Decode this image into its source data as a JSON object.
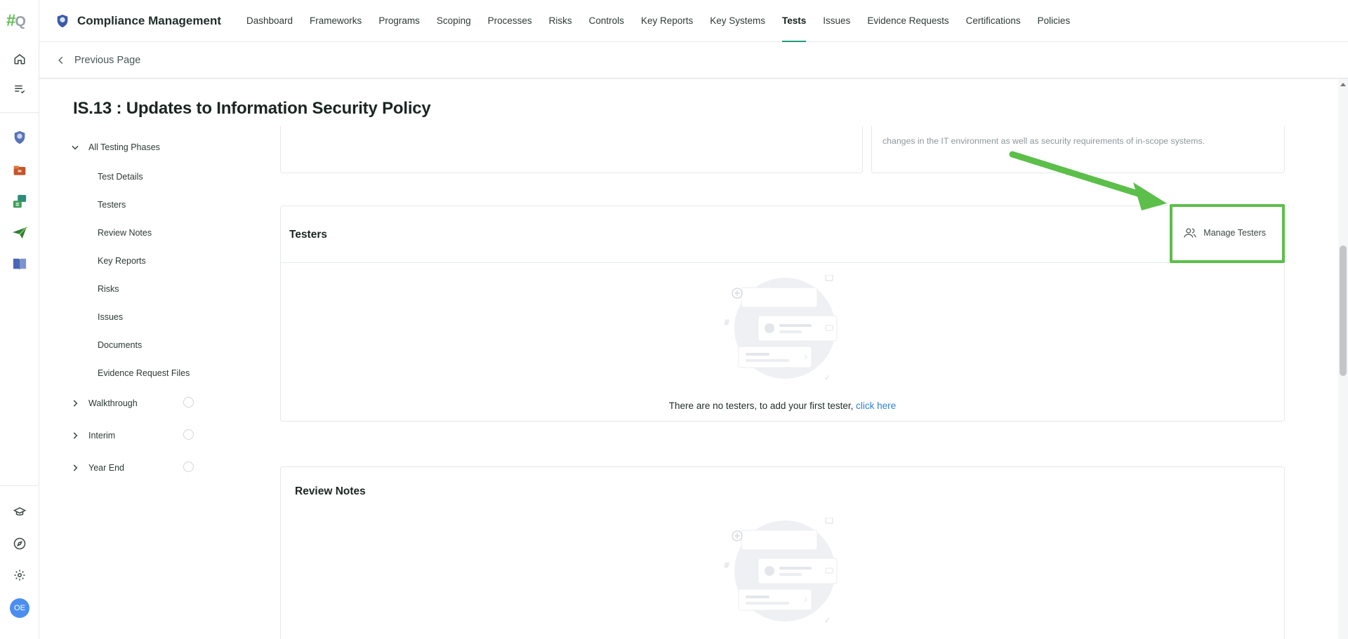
{
  "app": {
    "logo_hash": "#",
    "logo_q": "Q",
    "title": "Compliance Management"
  },
  "nav": {
    "items": [
      {
        "label": "Dashboard",
        "active": false
      },
      {
        "label": "Frameworks",
        "active": false
      },
      {
        "label": "Programs",
        "active": false
      },
      {
        "label": "Scoping",
        "active": false
      },
      {
        "label": "Processes",
        "active": false
      },
      {
        "label": "Risks",
        "active": false
      },
      {
        "label": "Controls",
        "active": false
      },
      {
        "label": "Key Reports",
        "active": false
      },
      {
        "label": "Key Systems",
        "active": false
      },
      {
        "label": "Tests",
        "active": true
      },
      {
        "label": "Issues",
        "active": false
      },
      {
        "label": "Evidence Requests",
        "active": false
      },
      {
        "label": "Certifications",
        "active": false
      },
      {
        "label": "Policies",
        "active": false
      }
    ]
  },
  "rail": {
    "icons": [
      "home-icon",
      "task-list-icon",
      "compliance-badge-icon",
      "folder-icon",
      "sync-icon",
      "send-icon",
      "book-icon",
      "courses-icon",
      "compass-icon",
      "gear-icon"
    ],
    "avatar_initials": "OE"
  },
  "back": {
    "label": "Previous Page"
  },
  "page": {
    "title": "IS.13 : Updates to Information Security Policy"
  },
  "tree": {
    "root": "All Testing Phases",
    "children": [
      "Test Details",
      "Testers",
      "Review Notes",
      "Key Reports",
      "Risks",
      "Issues",
      "Documents",
      "Evidence Request Files"
    ],
    "phases": [
      "Walkthrough",
      "Interim",
      "Year End"
    ]
  },
  "description": {
    "text": "changes in the IT environment as well as security requirements of in-scope systems."
  },
  "testers": {
    "title": "Testers",
    "manage_label": "Manage Testers",
    "empty_text": "There are no testers, to add your first tester, ",
    "empty_link": "click here"
  },
  "review_notes": {
    "title": "Review Notes"
  },
  "colors": {
    "accent_highlight": "#5cbf4a",
    "active_tab": "#1f9a7a",
    "link": "#2f7fd6",
    "avatar": "#4b8ef0"
  }
}
